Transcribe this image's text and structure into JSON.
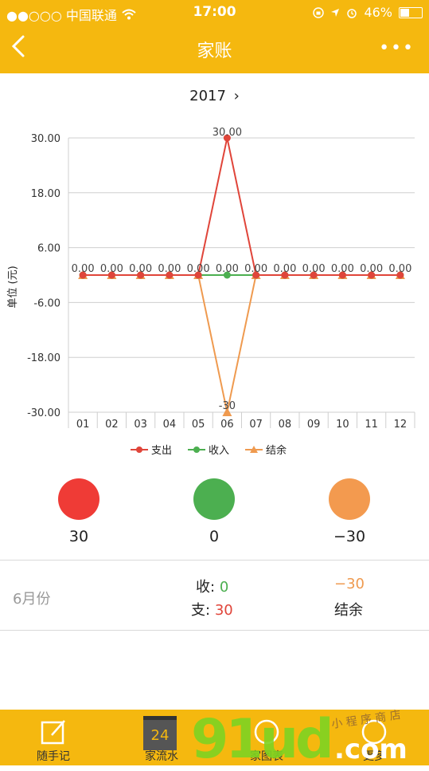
{
  "status_bar": {
    "carrier": "●●○○○ 中国联通",
    "time": "17:00",
    "battery": "46%",
    "battery_level": 0.46
  },
  "nav": {
    "back_icon": "chevron-left-icon",
    "title": "家账",
    "more_icon": "more-dots-icon",
    "more_label": "•••"
  },
  "year_selector": {
    "label": "2017",
    "arrow": "›"
  },
  "chart_data": {
    "type": "line",
    "ylabel": "单位 (元)",
    "yticks": [
      "30.00",
      "18.00",
      "6.00",
      "-6.00",
      "-18.00",
      "-30.00"
    ],
    "ylim": [
      -30,
      30
    ],
    "categories": [
      "01",
      "02",
      "03",
      "04",
      "05",
      "06",
      "07",
      "08",
      "09",
      "10",
      "11",
      "12"
    ],
    "series": [
      {
        "name": "支出",
        "color": "#E0453A",
        "marker": "circle",
        "values": [
          0,
          0,
          0,
          0,
          0,
          30,
          0,
          0,
          0,
          0,
          0,
          0
        ]
      },
      {
        "name": "收入",
        "color": "#4CAF50",
        "marker": "circle",
        "values": [
          0,
          0,
          0,
          0,
          0,
          0,
          0,
          0,
          0,
          0,
          0,
          0
        ]
      },
      {
        "name": "结余",
        "color": "#EF9A4F",
        "marker": "triangle",
        "values": [
          0,
          0,
          0,
          0,
          0,
          -30,
          0,
          0,
          0,
          0,
          0,
          0
        ]
      }
    ],
    "data_labels": {
      "peak": "30.00",
      "trough": "-30",
      "zero": "0.00"
    },
    "grid": true,
    "legend": "bottom"
  },
  "totals": {
    "expense": {
      "value": "30",
      "color": "#EF3B36"
    },
    "income": {
      "value": "0",
      "color": "#4CAF50"
    },
    "balance": {
      "value": "−30",
      "color": "#F39A4F"
    }
  },
  "month_detail": {
    "month": "6月份",
    "income_label": "收:",
    "income_value": "0",
    "expense_label": "支:",
    "expense_value": "30",
    "balance_value": "−30",
    "balance_label": "结余"
  },
  "tabbar": {
    "tabs": [
      {
        "label": "随手记",
        "icon": "notepad-edit-icon"
      },
      {
        "label": "家流水",
        "icon": "calendar-icon",
        "badge": "24"
      },
      {
        "label": "家图表",
        "icon": "chart-icon"
      },
      {
        "label": "更多",
        "icon": "more-icon"
      }
    ]
  },
  "watermark": {
    "brand": "91ud",
    "domain": ".com",
    "small_text": "小 程 序 商 店"
  }
}
